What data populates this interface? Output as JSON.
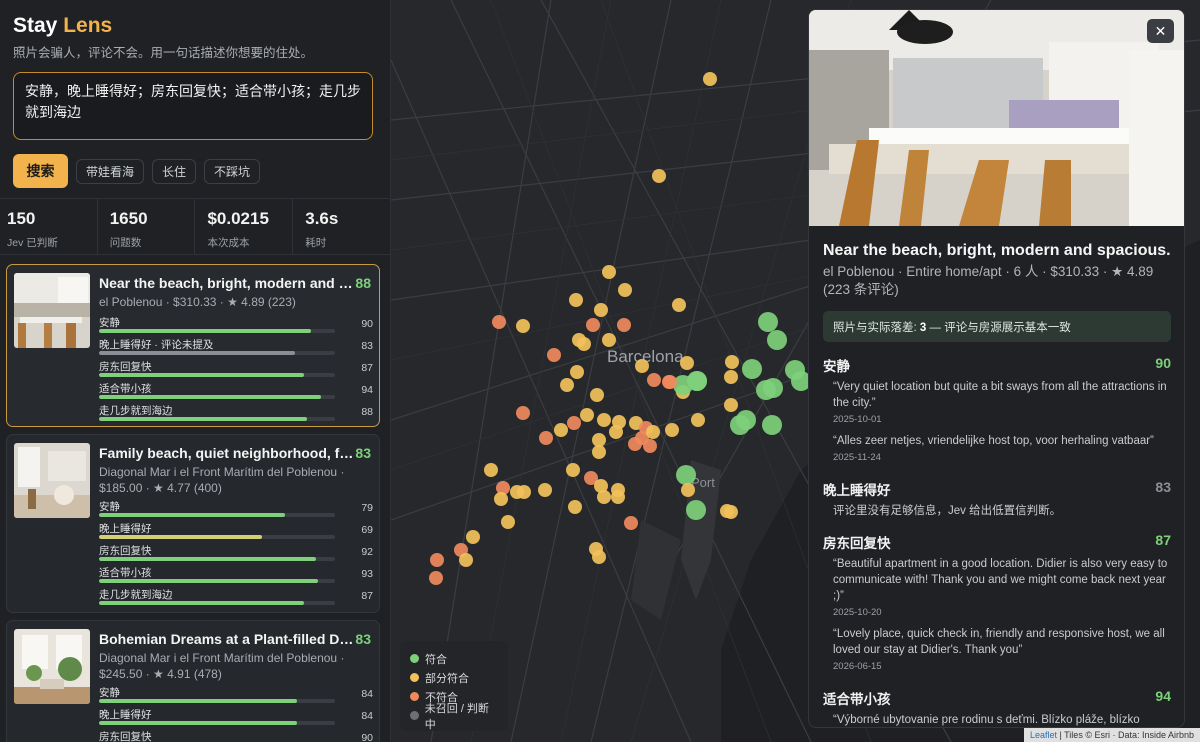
{
  "app": {
    "brand_main": "Stay",
    "brand_accent": "Lens",
    "tagline": "照片会骗人，评论不会。用一句话描述你想要的住处。",
    "query": "安静，晚上睡得好；房东回复快；适合带小孩；走几步就到海边",
    "search_label": "搜索",
    "chips": [
      "带娃看海",
      "长住",
      "不踩坑"
    ]
  },
  "stats": [
    {
      "value": "150",
      "label": "Jev 已判断"
    },
    {
      "value": "1650",
      "label": "问题数"
    },
    {
      "value": "$0.0215",
      "label": "本次成本"
    },
    {
      "value": "3.6s",
      "label": "耗时"
    }
  ],
  "listings": [
    {
      "title": "Near the beach, bright, modern and spa…",
      "score": "88",
      "meta": "el Poblenou · $310.33 · ★ 4.89 (223)",
      "criteria": [
        {
          "label": "安静",
          "value": "90"
        },
        {
          "label": "晚上睡得好 · 评论未提及",
          "value": "83"
        },
        {
          "label": "房东回复快",
          "value": "87"
        },
        {
          "label": "适合带小孩",
          "value": "94"
        },
        {
          "label": "走几步就到海边",
          "value": "88"
        }
      ]
    },
    {
      "title": "Family beach, quiet neighborhood, fully …",
      "score": "83",
      "meta": "Diagonal Mar i el Front Marítim del Poblenou · $185.00 · ★ 4.77 (400)",
      "criteria": [
        {
          "label": "安静",
          "value": "79"
        },
        {
          "label": "晚上睡得好",
          "value": "69"
        },
        {
          "label": "房东回复快",
          "value": "92"
        },
        {
          "label": "适合带小孩",
          "value": "93"
        },
        {
          "label": "走几步就到海边",
          "value": "87"
        }
      ]
    },
    {
      "title": "Bohemian Dreams at a Plant-filled Desig…",
      "score": "83",
      "meta": "Diagonal Mar i el Front Marítim del Poblenou · $245.50 · ★ 4.91 (478)",
      "criteria": [
        {
          "label": "安静",
          "value": "84"
        },
        {
          "label": "晚上睡得好",
          "value": "84"
        },
        {
          "label": "房东回复快",
          "value": "90"
        }
      ]
    }
  ],
  "map": {
    "city_label": "Barcelona",
    "port_label": "Port",
    "legend": [
      {
        "label": "符合",
        "color": "#7ed07b"
      },
      {
        "label": "部分符合",
        "color": "#f2c15a"
      },
      {
        "label": "不符合",
        "color": "#f08a5d"
      },
      {
        "label": "未召回 / 判断中",
        "color": "#6b6f76"
      }
    ],
    "attribution_leaflet": "Leaflet",
    "attribution_rest": " | Tiles © Esri · Data: Inside Airbnb"
  },
  "detail": {
    "close": "✕",
    "title": "Near the beach, bright, modern and spacious.",
    "meta": "el Poblenou · Entire home/apt · 6 人 · $310.33 · ★ 4.89 (223 条评论)",
    "gap_prefix": "照片与实际落差:",
    "gap_value": "3",
    "gap_suffix": "— 评论与房源展示基本一致",
    "sections": [
      {
        "name": "安静",
        "score": "90",
        "items": [
          {
            "quote": "“Very quiet location but quite a bit sways from all the attractions in the city.”",
            "date": "2025-10-01"
          },
          {
            "quote": "“Alles zeer netjes, vriendelijke host top, voor herhaling vatbaar”",
            "date": "2025-11-24"
          }
        ]
      },
      {
        "name": "晚上睡得好",
        "score": "83",
        "note": "评论里没有足够信息，Jev 给出低置信判断。"
      },
      {
        "name": "房东回复快",
        "score": "87",
        "items": [
          {
            "quote": "“Beautiful apartment in a good location. Didier is also very easy to communicate with! Thank you and we might come back next year ;)”",
            "date": "2025-10-20"
          },
          {
            "quote": "“Lovely place, quick check in, friendly and responsive host, we all loved our stay at Didier's. Thank you”",
            "date": "2026-06-15"
          }
        ]
      },
      {
        "name": "适合带小孩",
        "score": "94",
        "items": [
          {
            "quote": "“Výborné ubytovanie pre rodinu s deťmi. Blízko pláže, blízko",
            "date": ""
          }
        ]
      }
    ]
  }
}
